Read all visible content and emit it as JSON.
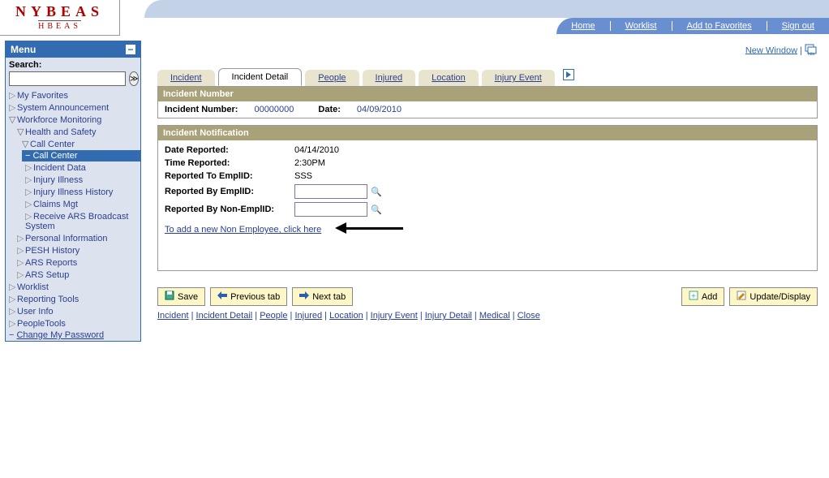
{
  "logo": {
    "main": "NYBEAS",
    "sub": "HBEAS"
  },
  "header_nav": {
    "home": "Home",
    "worklist": "Worklist",
    "fav": "Add to Favorites",
    "signout": "Sign out"
  },
  "menu": {
    "title": "Menu",
    "search_label": "Search:",
    "items": {
      "fav": "My Favorites",
      "sysann": "System Announcement",
      "wfm": "Workforce Monitoring",
      "hs": "Health and Safety",
      "cc": "Call Center",
      "cc_active": "Call Center",
      "incdata": "Incident Data",
      "injill": "Injury Illness",
      "injillhist": "Injury Illness History",
      "claims": "Claims Mgt",
      "ars": "Receive ARS Broadcast System",
      "persinfo": "Personal Information",
      "pesh": "PESH History",
      "arsrep": "ARS Reports",
      "arssetup": "ARS Setup",
      "worklist": "Worklist",
      "reptool": "Reporting Tools",
      "userinfo": "User Info",
      "ptools": "PeopleTools",
      "chgpwd": "Change My Password"
    }
  },
  "util": {
    "new_window": "New Window"
  },
  "tabs": {
    "incident": "Incident",
    "detail": "Incident Detail",
    "people": "People",
    "injured": "Injured",
    "location": "Location",
    "injevent": "Injury Event"
  },
  "inc_num_panel": {
    "header": "Incident Number",
    "num_label": "Incident Number:",
    "num_value": "00000000",
    "date_label": "Date:",
    "date_value": "04/09/2010"
  },
  "notif_panel": {
    "header": "Incident Notification",
    "date_rep_label": "Date Reported:",
    "date_rep_value": "04/14/2010",
    "time_rep_label": "Time Reported:",
    "time_rep_value": "2:30PM",
    "rep_to_label": "Reported To EmplID:",
    "rep_to_value": "SSS",
    "rep_by_label": "Reported By EmplID:",
    "rep_by_non_label": "Reported By Non-EmplID:",
    "add_link": "To add a new Non Employee, click here"
  },
  "buttons": {
    "save": "Save",
    "prev": "Previous tab",
    "next": "Next tab",
    "add": "Add",
    "update": "Update/Display"
  },
  "footer": {
    "incident": "Incident",
    "detail": "Incident Detail",
    "people": "People",
    "injured": "Injured",
    "location": "Location",
    "injevent": "Injury Event",
    "injdetail": "Injury Detail",
    "medical": "Medical",
    "close": "Close"
  }
}
